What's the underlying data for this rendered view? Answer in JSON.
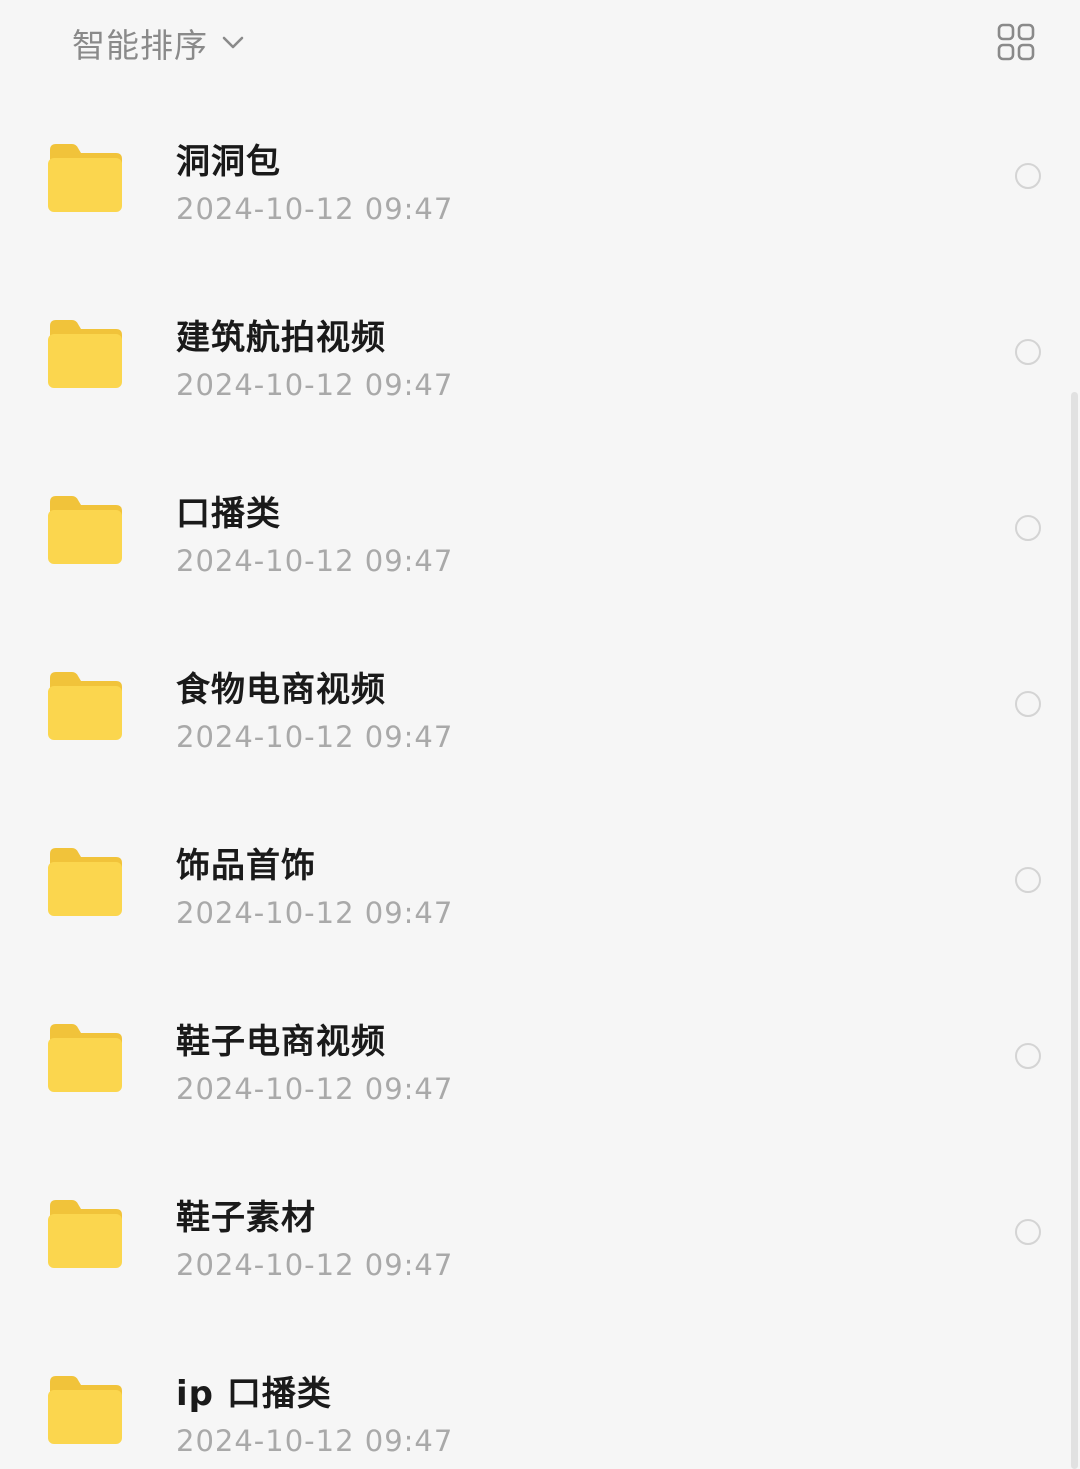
{
  "header": {
    "sort_label": "智能排序",
    "sort_icon": "chevron-down-icon",
    "view_toggle_icon": "grid-view-icon"
  },
  "folders": [
    {
      "name": "洞洞包",
      "date": "2024-10-12 09:47",
      "has_select": true
    },
    {
      "name": "建筑航拍视频",
      "date": "2024-10-12 09:47",
      "has_select": true
    },
    {
      "name": "口播类",
      "date": "2024-10-12 09:47",
      "has_select": true
    },
    {
      "name": "食物电商视频",
      "date": "2024-10-12 09:47",
      "has_select": true
    },
    {
      "name": "饰品首饰",
      "date": "2024-10-12 09:47",
      "has_select": true
    },
    {
      "name": "鞋子电商视频",
      "date": "2024-10-12 09:47",
      "has_select": true
    },
    {
      "name": "鞋子素材",
      "date": "2024-10-12 09:47",
      "has_select": true
    },
    {
      "name": "ip 口播类",
      "date": "2024-10-12 09:47",
      "has_select": false
    }
  ],
  "colors": {
    "background": "#f6f6f6",
    "folder_front": "#fbd64e",
    "folder_back": "#f1c33a",
    "title_text": "#1a1a1a",
    "date_text": "#a9a9a9"
  }
}
